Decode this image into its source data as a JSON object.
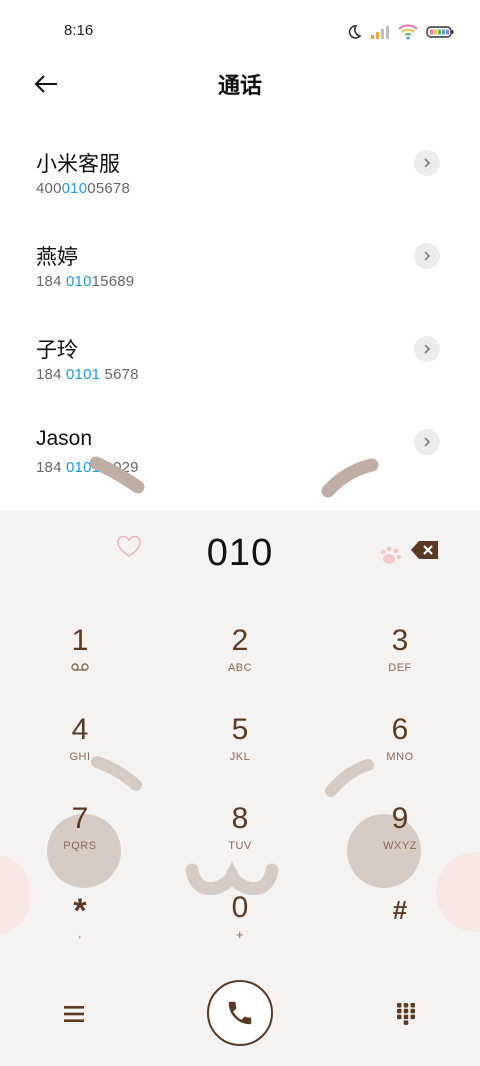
{
  "status_bar": {
    "time": "8:16"
  },
  "header": {
    "title": "通话"
  },
  "contacts": [
    {
      "name": "小米客服",
      "number_pre": "400",
      "number_hl": "010",
      "number_post": "05678"
    },
    {
      "name": "燕婷",
      "number_pre": "184 ",
      "number_hl": "010",
      "number_post": "15689"
    },
    {
      "name": "子玲",
      "number_pre": "184 ",
      "number_hl": "0101",
      "number_post": " 5678"
    },
    {
      "name": "Jason",
      "number_pre": "184 ",
      "number_hl": "0101",
      "number_post": " 0029"
    }
  ],
  "dialer": {
    "input": "010",
    "keys": [
      {
        "digit": "1",
        "letters": ""
      },
      {
        "digit": "2",
        "letters": "ABC"
      },
      {
        "digit": "3",
        "letters": "DEF"
      },
      {
        "digit": "4",
        "letters": "GHI"
      },
      {
        "digit": "5",
        "letters": "JKL"
      },
      {
        "digit": "6",
        "letters": "MNO"
      },
      {
        "digit": "7",
        "letters": "PQRS"
      },
      {
        "digit": "8",
        "letters": "TUV"
      },
      {
        "digit": "9",
        "letters": "WXYZ"
      },
      {
        "digit": "*",
        "letters": ","
      },
      {
        "digit": "0",
        "letters": "+"
      },
      {
        "digit": "#",
        "letters": ""
      }
    ]
  },
  "icons": {
    "back": "arrow-left-icon",
    "chevron": "chevron-right-icon",
    "backspace": "backspace-icon",
    "voicemail": "voicemail-icon",
    "menu": "menu-icon",
    "call": "phone-icon",
    "keypad": "keypad-icon"
  },
  "colors": {
    "accent": "#1e9ae0",
    "dial_brown": "#5a3a24",
    "dialpad_bg": "#f5f3f2"
  }
}
